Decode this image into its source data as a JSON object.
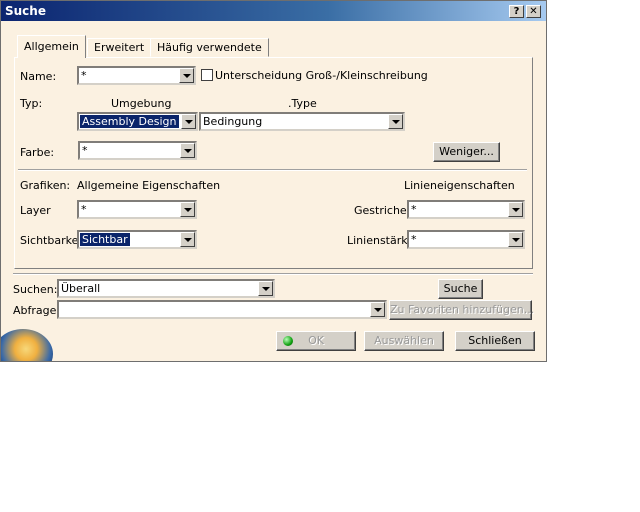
{
  "window": {
    "title": "Suche",
    "help_label": "?",
    "close_label": "✕"
  },
  "tabs": [
    {
      "label": "Allgemein",
      "active": true
    },
    {
      "label": "Erweitert",
      "active": false
    },
    {
      "label": "Häufig verwendete",
      "active": false
    }
  ],
  "general": {
    "name_label": "Name:",
    "name_value": "*",
    "case_label": "Unterscheidung Groß-/Kleinschreibung",
    "case_checked": false,
    "type_label": "Typ:",
    "env_header": "Umgebung",
    "type_header": ".Type",
    "env_value": "Assembly Design",
    "type_value": "Bedingung",
    "color_label": "Farbe:",
    "color_value": "*",
    "less_button": "Weniger...",
    "graphics_label": "Grafiken:",
    "general_props": "Allgemeine Eigenschaften",
    "line_props": "Linieneigenschaften",
    "layer_label": "Layer",
    "layer_value": "*",
    "dashed_label": "Gestrichelt",
    "dashed_value": "*",
    "visibility_label": "Sichtbarkeit",
    "visibility_value": "Sichtbar",
    "thickness_label": "Linienstärke",
    "thickness_value": "*"
  },
  "search": {
    "search_label": "Suchen:",
    "search_value": "Überall",
    "search_button": "Suche",
    "query_label": "Abfrage:",
    "query_value": "",
    "favorites_button": "Zu Favoriten hinzufügen..."
  },
  "footer": {
    "ok_button": "OK",
    "select_button": "Auswählen",
    "close_button": "Schließen"
  },
  "colors": {
    "selection": "#0a246a",
    "background": "#fbf1e1",
    "title_start": "#0b2470",
    "title_end": "#a6caf0"
  }
}
